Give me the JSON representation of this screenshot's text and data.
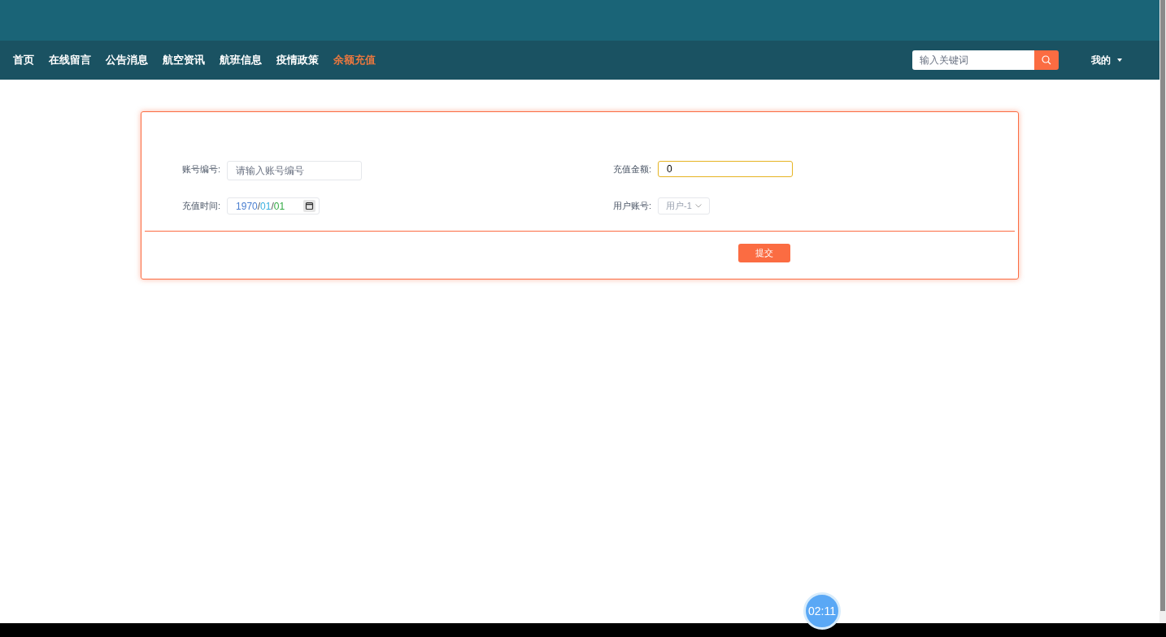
{
  "nav": [
    {
      "label": "首页",
      "selected": false
    },
    {
      "label": "在线留言",
      "selected": false
    },
    {
      "label": "公告消息",
      "selected": false
    },
    {
      "label": "航空资讯",
      "selected": false
    },
    {
      "label": "航班信息",
      "selected": false
    },
    {
      "label": "疫情政策",
      "selected": false
    },
    {
      "label": "余额充值",
      "selected": true
    }
  ],
  "search": {
    "placeholder": "输入关键词"
  },
  "user_menu": "我的",
  "form": {
    "account_no": {
      "label": "账号编号:",
      "placeholder": "请输入账号编号"
    },
    "amount": {
      "label": "充值金额:",
      "value": "0"
    },
    "time": {
      "label": "充值时间:",
      "parts": [
        {
          "text": "1970",
          "color": "#4a7fd0"
        },
        {
          "text": "/"
        },
        {
          "text": "01",
          "color": "#3ab0e0"
        },
        {
          "text": "/"
        },
        {
          "text": "01",
          "color": "#33aa44"
        }
      ]
    },
    "user_account": {
      "label": "用户账号:",
      "value": "用户-1"
    },
    "submit": "提交"
  },
  "timer": "02:11"
}
